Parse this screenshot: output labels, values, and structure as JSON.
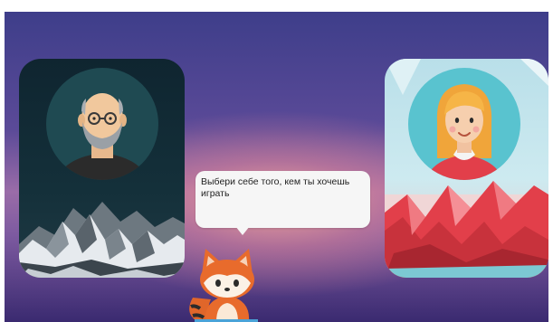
{
  "scene": {
    "background_top": "#3e3e8a",
    "background_glow": "#f8a896"
  },
  "characters": [
    {
      "id": "male",
      "icon": "bald-man-with-glasses-avatar-icon",
      "card_background": "mountain-landscape",
      "accent": "#0f2530"
    },
    {
      "id": "female",
      "icon": "blonde-woman-avatar-icon",
      "card_background": "red-lowpoly-landscape",
      "accent": "#e8474f"
    }
  ],
  "speech_bubble": {
    "text": "Выбери себе того, кем ты хочешь играть"
  },
  "mascot": {
    "icon": "red-panda-fox-icon"
  }
}
